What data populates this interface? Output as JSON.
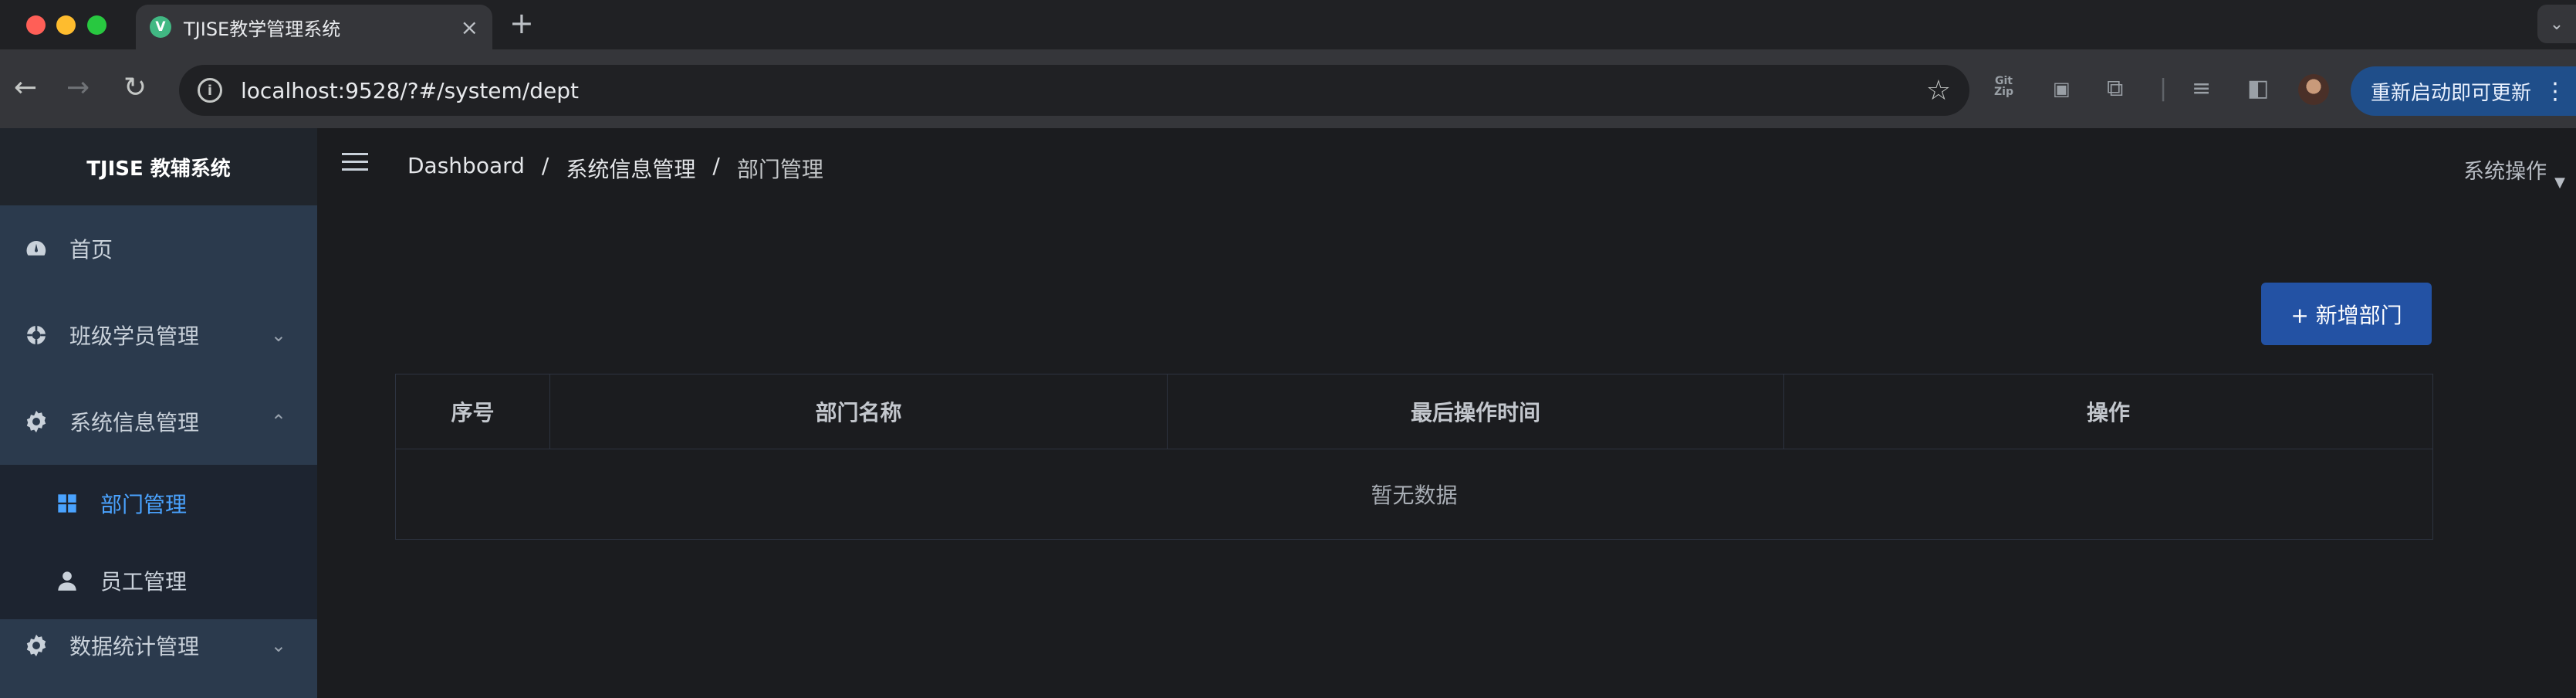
{
  "browser": {
    "tab_title": "TJISE教学管理系统",
    "favicon_letter": "V",
    "tab_close": "×",
    "new_tab": "+",
    "url": "localhost:9528/?#/system/dept",
    "update_button": "重新启动即可更新",
    "ext_gitzip_top": "Git",
    "ext_gitzip_bottom": "Zip",
    "icons": [
      "back-icon",
      "forward-icon",
      "reload-icon",
      "info-icon",
      "star-icon",
      "gitzip-icon",
      "screenshot-icon",
      "extensions-icon",
      "media-icon",
      "side-panel-icon",
      "profile-avatar",
      "more-icon"
    ]
  },
  "sidebar": {
    "brand": "TJISE 教辅系统",
    "items": [
      {
        "label": "首页",
        "icon": "dashboard-icon"
      },
      {
        "label": "班级学员管理",
        "icon": "gear-icon",
        "chevron": "down"
      },
      {
        "label": "系统信息管理",
        "icon": "gear-icon",
        "chevron": "up"
      },
      {
        "label": "数据统计管理",
        "icon": "gear-icon",
        "chevron": "down"
      }
    ],
    "submenu": [
      {
        "label": "部门管理",
        "icon": "grid-icon",
        "active": true
      },
      {
        "label": "员工管理",
        "icon": "user-icon",
        "active": false
      }
    ],
    "active_color": "#4aa3ff"
  },
  "header": {
    "breadcrumb": [
      "Dashboard",
      "系统信息管理",
      "部门管理"
    ],
    "separator": "/",
    "system_ops": "系统操作"
  },
  "main": {
    "add_button": "+ 新增部门",
    "table": {
      "columns": [
        "序号",
        "部门名称",
        "最后操作时间",
        "操作"
      ],
      "empty_text": "暂无数据"
    }
  }
}
